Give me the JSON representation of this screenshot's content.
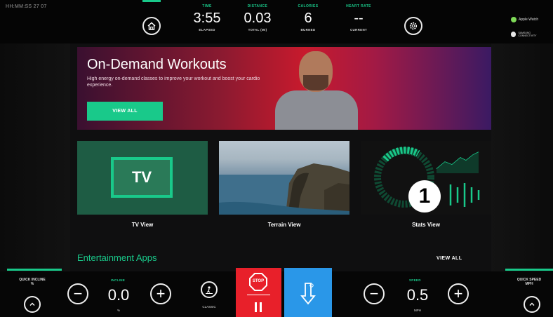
{
  "topbar": {
    "clock": "HH:MM:SS 27 07",
    "stats": [
      {
        "label": "TIME",
        "value": "3:55",
        "sub": "ELAPSED"
      },
      {
        "label": "DISTANCE",
        "value": "0.03",
        "sub": "TOTAL (MI)"
      },
      {
        "label": "CALORIES",
        "value": "6",
        "sub": "BURNED"
      },
      {
        "label": "HEART RATE",
        "value": "--",
        "sub": "CURRENT"
      }
    ],
    "apple_watch": "Apple Watch",
    "samsung": "SAMSUNG CONNECTIVITY"
  },
  "banner": {
    "title": "On-Demand Workouts",
    "description": "High energy on-demand classes to improve your workout and boost your cardio experience.",
    "button": "VIEW ALL"
  },
  "tiles": [
    {
      "label": "TV View",
      "icon_text": "TV"
    },
    {
      "label": "Terrain View"
    },
    {
      "label": "Stats View",
      "badge": "1"
    }
  ],
  "entertainment": {
    "title": "Entertainment Apps",
    "view_all": "VIEW ALL"
  },
  "bottom": {
    "quick_incline": "QUICK INCLINE\n%",
    "incline": {
      "label": "INCLINE",
      "value": "0.0",
      "unit": "%"
    },
    "classic": "CLASSIC",
    "stop": "STOP",
    "speed": {
      "label": "SPEED",
      "value": "0.5",
      "unit": "MPH"
    },
    "quick_speed": "QUICK SPEED\nMPH"
  },
  "colors": {
    "accent": "#19c98a",
    "stop": "#e8202a",
    "start": "#2a97e8"
  }
}
